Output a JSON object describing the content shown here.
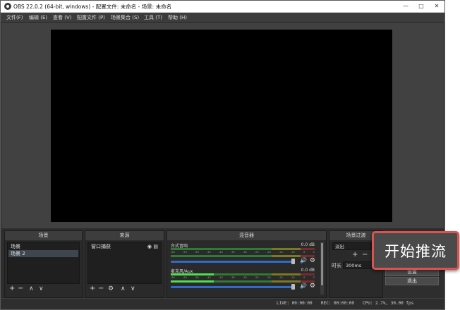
{
  "window": {
    "title": "OBS 22.0.2 (64-bit, windows) - 配置文件: 未命名 - 场景: 未命名"
  },
  "menu": [
    "文件(F)",
    "编辑 (E)",
    "查看 (V)",
    "配置文件 (P)",
    "场景集合 (S)",
    "工具 (T)",
    "帮助 (H)"
  ],
  "docks": {
    "scenes": {
      "title": "场景",
      "items": [
        "场景",
        "场景 2"
      ]
    },
    "sources": {
      "title": "来源",
      "items": [
        "窗口捕获"
      ]
    },
    "mixer": {
      "title": "混音器",
      "channels": [
        {
          "name": "台式音响",
          "db": "0.0 dB",
          "level": 0.0,
          "volume": 1.0
        },
        {
          "name": "麦克风/Aux",
          "db": "0.0 dB",
          "level": 0.78,
          "volume": 1.0
        }
      ],
      "ticks": [
        "-60",
        "-55",
        "-50",
        "-45",
        "-40",
        "-35",
        "-30",
        "-25",
        "-20",
        "-15",
        "-10",
        "-5",
        "0"
      ]
    },
    "transitions": {
      "title": "场景过渡",
      "transition_value": "淡出",
      "duration_label": "时长",
      "duration_value": "300ms"
    }
  },
  "controls": {
    "start_stream": "开始推流",
    "studio_mode": "设置",
    "exit": "退出"
  },
  "status": {
    "live": "LIVE: 00:00:00",
    "rec": "REC: 00:00:00",
    "cpu": "CPU: 2.7%, 30.00 fps"
  },
  "colors": {
    "background": "#2e2e2e",
    "preview": "#000000",
    "highlight_border": "#d9534f"
  }
}
